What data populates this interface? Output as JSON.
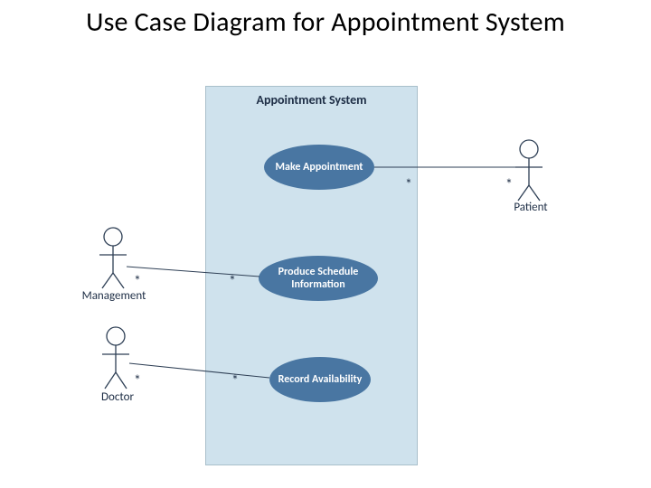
{
  "slide": {
    "title": "Use Case Diagram for Appointment System"
  },
  "diagram": {
    "system_name": "Appointment System",
    "actors": {
      "management": "Management",
      "doctor": "Doctor",
      "patient": "Patient"
    },
    "usecases": {
      "make_appt": "Make Appointment",
      "produce_schedule": "Produce Schedule Information",
      "record_avail": "Record Availability"
    },
    "multiplicities": {
      "star": "*"
    },
    "associations": [
      {
        "actor": "Patient",
        "usecase": "Make Appointment",
        "actor_mult": "*",
        "uc_mult": "*"
      },
      {
        "actor": "Management",
        "usecase": "Produce Schedule Information",
        "actor_mult": "*",
        "uc_mult": "*"
      },
      {
        "actor": "Doctor",
        "usecase": "Record Availability",
        "actor_mult": "*",
        "uc_mult": "*"
      }
    ]
  },
  "colors": {
    "system_fill": "#cfe2ed",
    "usecase_fill": "#4976a2"
  }
}
